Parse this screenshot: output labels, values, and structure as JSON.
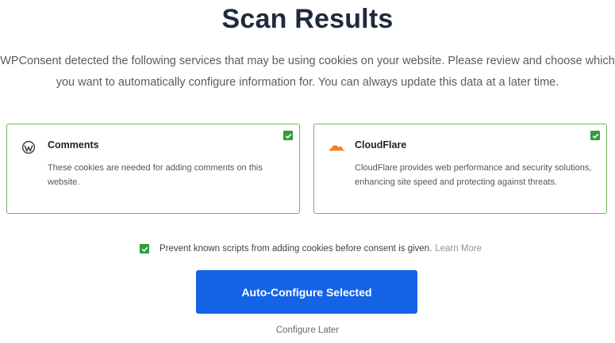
{
  "page": {
    "title": "Scan Results",
    "intro_line1": "WPConsent detected the following services that may be using cookies on your website. Please review and choose which",
    "intro_line2": "you want to automatically configure information for. You can always update this data at a later time."
  },
  "services": [
    {
      "name": "Comments",
      "icon": "wordpress-icon",
      "checked": true,
      "description": "These cookies are needed for adding comments on this website."
    },
    {
      "name": "CloudFlare",
      "icon": "cloudflare-icon",
      "checked": true,
      "description": "CloudFlare provides web performance and security solutions, enhancing site speed and protecting against threats."
    }
  ],
  "prevent": {
    "checked": true,
    "label": "Prevent known scripts from adding cookies before consent is given.",
    "learn_more": "Learn More"
  },
  "actions": {
    "primary": "Auto-Configure Selected",
    "secondary": "Configure Later"
  },
  "colors": {
    "accent": "#1563e6",
    "check_green": "#2f9e3b",
    "card_border": "#6cb85c",
    "cloudflare_orange": "#f38020"
  }
}
